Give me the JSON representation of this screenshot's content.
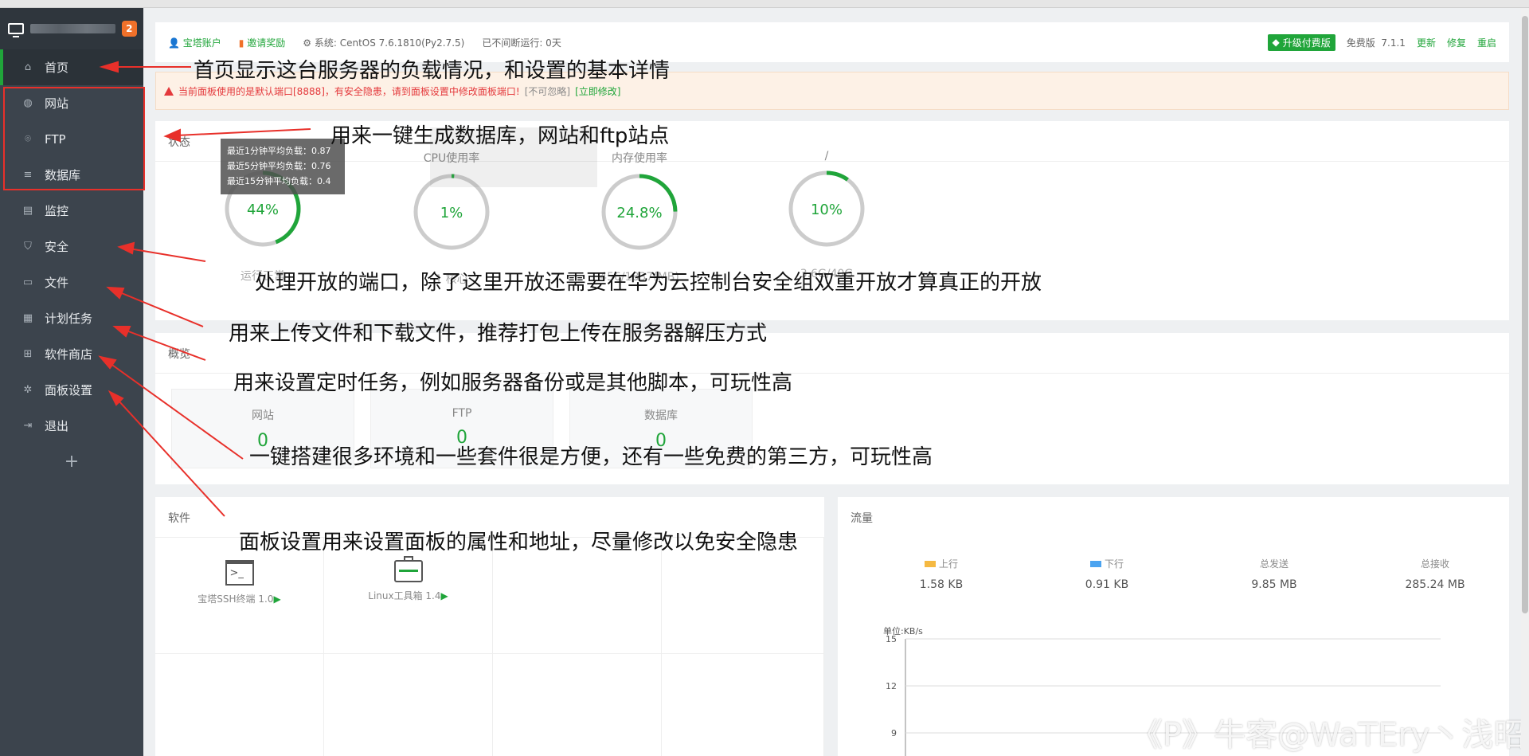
{
  "sidebar": {
    "badge": "2",
    "items": [
      {
        "label": "首页",
        "icon": "home-icon",
        "glyph": "⌂"
      },
      {
        "label": "网站",
        "icon": "globe-icon",
        "glyph": "◍"
      },
      {
        "label": "FTP",
        "icon": "ftp-icon",
        "glyph": "⌾"
      },
      {
        "label": "数据库",
        "icon": "database-icon",
        "glyph": "≡"
      },
      {
        "label": "监控",
        "icon": "monitor-icon",
        "glyph": "▤"
      },
      {
        "label": "安全",
        "icon": "shield-icon",
        "glyph": "⛉"
      },
      {
        "label": "文件",
        "icon": "folder-icon",
        "glyph": "▭"
      },
      {
        "label": "计划任务",
        "icon": "calendar-icon",
        "glyph": "▦"
      },
      {
        "label": "软件商店",
        "icon": "apps-icon",
        "glyph": "⊞"
      },
      {
        "label": "面板设置",
        "icon": "gear-icon",
        "glyph": "✲"
      },
      {
        "label": "退出",
        "icon": "logout-icon",
        "glyph": "⇥"
      }
    ],
    "plus": "+"
  },
  "topbar": {
    "account": "宝塔账户",
    "invite": "邀请奖励",
    "system": "系统:  CentOS 7.6.1810(Py2.7.5)",
    "uptime": "已不间断运行: 0天",
    "upgrade": "升级付费版",
    "edition": "免费版",
    "version": "7.1.1",
    "update": "更新",
    "repair": "修复",
    "restart": "重启"
  },
  "warning": {
    "text": "当前面板使用的是默认端口[8888]，有安全隐患，请到面板设置中修改面板端口!",
    "ignore": "[不可忽略]",
    "fix": "[立即修改]"
  },
  "status": {
    "title": "状态",
    "tooltip": [
      "最近1分钟平均负载：0.87",
      "最近5分钟平均负载：0.76",
      "最近15分钟平均负载：0.4"
    ],
    "gauges": [
      {
        "label": "",
        "value": "44%",
        "pct": 0.44,
        "sub": "运行正常"
      },
      {
        "label": "CPU使用率",
        "value": "1%",
        "pct": 0.01,
        "sub": "1 核心"
      },
      {
        "label": "内存使用率",
        "value": "24.8%",
        "pct": 0.248,
        "sub": "456/1837(MB)"
      },
      {
        "label": "/",
        "value": "10%",
        "pct": 0.1,
        "sub": "3.6G/40G"
      }
    ]
  },
  "overview": {
    "title": "概览",
    "stats": [
      {
        "label": "网站",
        "value": "0"
      },
      {
        "label": "FTP",
        "value": "0"
      },
      {
        "label": "数据库",
        "value": "0"
      }
    ]
  },
  "software": {
    "title": "软件",
    "items": [
      {
        "name": "宝塔SSH终端 1.0",
        "icon": "terminal-icon"
      },
      {
        "name": "Linux工具箱 1.4",
        "icon": "toolbox-icon"
      }
    ]
  },
  "traffic": {
    "title": "流量",
    "cols": [
      {
        "label": "上行",
        "value": "1.58 KB",
        "color": "#f5b942"
      },
      {
        "label": "下行",
        "value": "0.91 KB",
        "color": "#4aa3f0"
      },
      {
        "label": "总发送",
        "value": "9.85 MB",
        "color": ""
      },
      {
        "label": "总接收",
        "value": "285.24 MB",
        "color": ""
      }
    ],
    "unit": "单位:KB/s",
    "yticks": [
      "15",
      "12",
      "9"
    ]
  },
  "notes": [
    "首页显示这台服务器的负载情况，和设置的基本详情",
    "用来一键生成数据库，网站和ftp站点",
    "处理开放的端口，除了这里开放还需要在华为云控制台安全组双重开放才算真正的开放",
    "用来上传文件和下载文件，推荐打包上传在服务器解压方式",
    "用来设置定时任务，例如服务器备份或是其他脚本，可玩性高",
    "一键搭建很多环境和一些套件很是方便，还有一些免费的第三方，可玩性高",
    "面板设置用来设置面板的属性和地址，尽量修改以免安全隐患"
  ],
  "watermark": "《P》牛客@WaTEry丶浅昭",
  "colors": {
    "accent": "#20a53a",
    "sidebar": "#3c444d",
    "warn": "#e4393c",
    "annotation": "#e8302a"
  }
}
